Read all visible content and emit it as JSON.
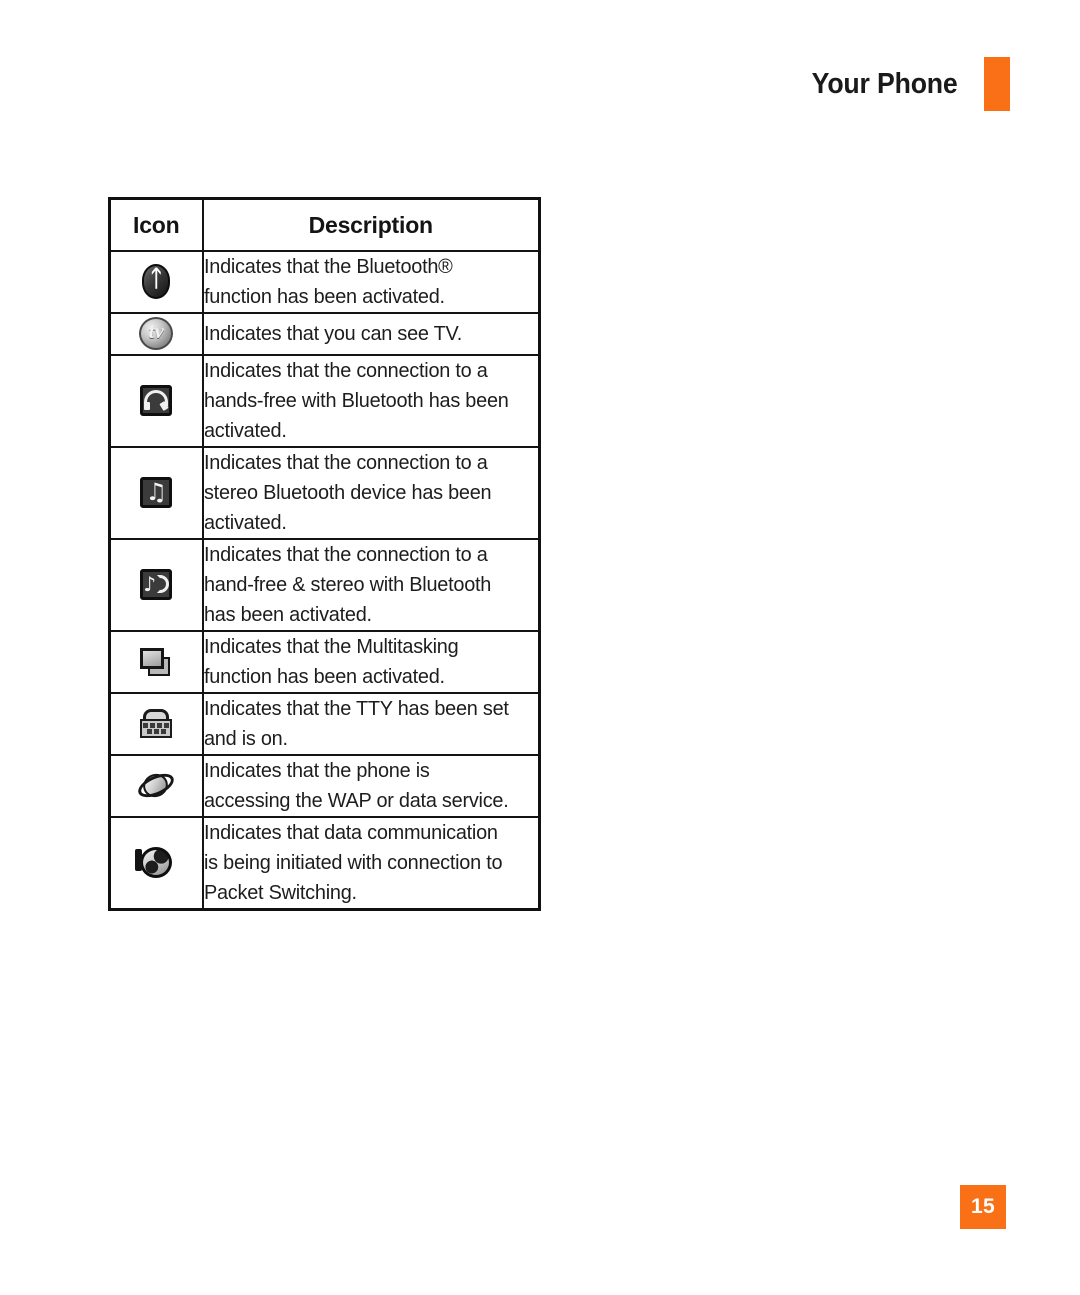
{
  "header": {
    "title": "Your Phone",
    "accent_color": "#FA7016",
    "bar_icon": "orange-bar-icon"
  },
  "table": {
    "columns": {
      "icon": "Icon",
      "description": "Description"
    },
    "rows": [
      {
        "icon_name": "bluetooth-icon",
        "description_lines": [
          "Indicates that the Bluetooth®",
          "function has been activated."
        ],
        "description": "Indicates that the Bluetooth® function has been activated."
      },
      {
        "icon_name": "tv-icon",
        "description_lines": [
          "Indicates that you can see TV."
        ],
        "description": "Indicates that you can see TV."
      },
      {
        "icon_name": "bluetooth-handsfree-headset-icon",
        "description_lines": [
          "Indicates that the connection to a",
          "hands-free with Bluetooth has been",
          "activated."
        ],
        "description": "Indicates that the connection to a hands-free with Bluetooth has been activated."
      },
      {
        "icon_name": "bluetooth-stereo-music-icon",
        "description_lines": [
          "Indicates that the connection to a",
          "stereo Bluetooth device has been",
          "activated."
        ],
        "description": "Indicates that the connection to a stereo Bluetooth device has been activated."
      },
      {
        "icon_name": "bluetooth-handsfree-stereo-icon",
        "description_lines": [
          "Indicates that the connection to a",
          "hand-free & stereo with Bluetooth",
          "has been activated."
        ],
        "description": "Indicates that the connection to a hand-free & stereo with Bluetooth has been activated."
      },
      {
        "icon_name": "multitasking-icon",
        "description_lines": [
          "Indicates that the Multitasking",
          "function has been activated."
        ],
        "description": "Indicates that the Multitasking function has been activated."
      },
      {
        "icon_name": "tty-telephone-icon",
        "description_lines": [
          "Indicates that the TTY has been set",
          "and is on."
        ],
        "description": "Indicates that the TTY has been set and is on."
      },
      {
        "icon_name": "wap-planet-icon",
        "description_lines": [
          "Indicates that the phone is",
          "accessing the WAP or data service."
        ],
        "description": "Indicates that the phone is accessing the WAP or data service."
      },
      {
        "icon_name": "packet-switching-globe-icon",
        "description_lines": [
          "Indicates that data communication",
          "is being initiated with connection to",
          "Packet Switching."
        ],
        "description": "Indicates that data communication is being initiated with connection to Packet Switching."
      }
    ]
  },
  "footer": {
    "page_number": "15",
    "badge_color": "#FA7016"
  }
}
